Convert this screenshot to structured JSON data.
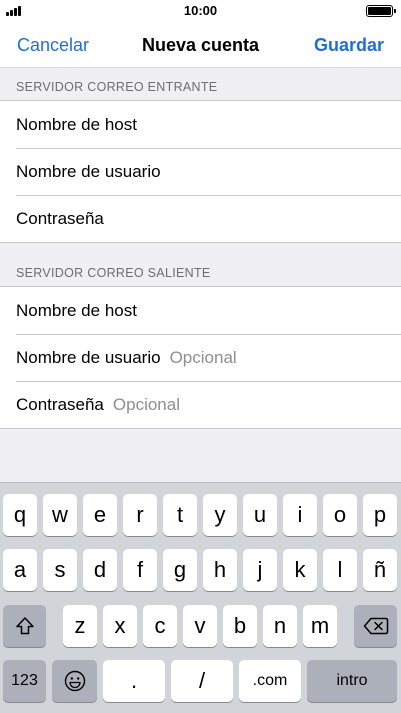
{
  "status": {
    "time": "10:00"
  },
  "nav": {
    "cancel": "Cancelar",
    "title": "Nueva cuenta",
    "save": "Guardar"
  },
  "incoming": {
    "header": "SERVIDOR CORREO ENTRANTE",
    "host": "Nombre de host",
    "user": "Nombre de usuario",
    "password": "Contraseña"
  },
  "outgoing": {
    "header": "SERVIDOR CORREO SALIENTE",
    "host": "Nombre de host",
    "user": "Nombre de usuario",
    "user_placeholder": "Opcional",
    "password": "Contraseña",
    "password_placeholder": "Opcional"
  },
  "keyboard": {
    "row1": [
      "q",
      "w",
      "e",
      "r",
      "t",
      "y",
      "u",
      "i",
      "o",
      "p"
    ],
    "row2": [
      "a",
      "s",
      "d",
      "f",
      "g",
      "h",
      "j",
      "k",
      "l",
      "ñ"
    ],
    "row3": [
      "z",
      "x",
      "c",
      "v",
      "b",
      "n",
      "m"
    ],
    "numbers_key": "123",
    "dot_key": ".",
    "slash_key": "/",
    "com_key": ".com",
    "enter_key": "intro",
    "icons": {
      "shift": "shift-icon",
      "delete": "backspace-icon",
      "emoji": "emoji-icon"
    }
  }
}
